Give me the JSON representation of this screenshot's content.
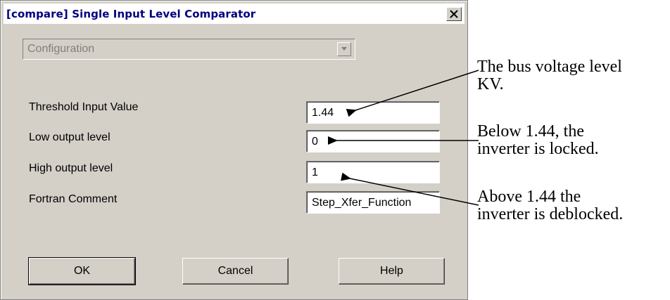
{
  "window": {
    "title": "[compare] Single Input Level Comparator",
    "close_label": "×"
  },
  "config": {
    "selected": "Configuration"
  },
  "fields": [
    {
      "label": "Threshold Input Value",
      "value": "1.44"
    },
    {
      "label": "Low output level",
      "value": "0"
    },
    {
      "label": "High output level",
      "value": "1"
    },
    {
      "label": "Fortran Comment",
      "value": "Step_Xfer_Function"
    }
  ],
  "buttons": {
    "ok": "OK",
    "cancel": "Cancel",
    "help": "Help"
  },
  "annotations": {
    "a1_line1": "The bus voltage level",
    "a1_line2": "KV.",
    "a2_line1": "Below 1.44, the",
    "a2_line2": "inverter is locked.",
    "a3_line1": "Above 1.44 the",
    "a3_line2": "inverter is deblocked."
  }
}
